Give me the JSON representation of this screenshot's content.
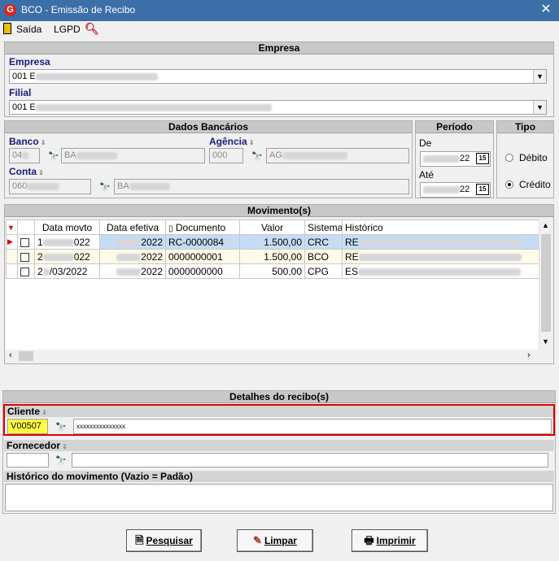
{
  "window": {
    "title": "BCO - Emissão de Recibo",
    "close": "✕",
    "icon_letter": "G"
  },
  "menu": {
    "exit": "Saída",
    "lgpd": "LGPD"
  },
  "empresa": {
    "header": "Empresa",
    "empresa_label": "Empresa",
    "empresa_value": "001 E",
    "filial_label": "Filial",
    "filial_value": "001 E"
  },
  "dados_bancarios": {
    "header": "Dados Bancários",
    "banco_label": "Banco",
    "banco_code": "04",
    "banco_name": "BA",
    "agencia_label": "Agência",
    "agencia_code": "000",
    "agencia_name": "AG",
    "conta_label": "Conta",
    "conta_code": "060",
    "conta_name": "BA"
  },
  "periodo": {
    "header": "Período",
    "de_label": "De",
    "de_value": "22",
    "ate_label": "Até",
    "ate_value": "22",
    "cal": "15"
  },
  "tipo": {
    "header": "Tipo",
    "debito": "Débito",
    "credito": "Crédito",
    "selected": "Crédito"
  },
  "movimentos": {
    "header": "Movimento(s)",
    "columns": [
      "Data movto",
      "Data efetiva",
      "Documento",
      "Valor",
      "Sistema",
      "Histórico"
    ],
    "rows": [
      {
        "data_movto": "1",
        "data_movto_end": "022",
        "data_efetiva": "2022",
        "documento": "RC-0000084",
        "valor": "1.500,00",
        "sistema": "CRC",
        "historico": "RE"
      },
      {
        "data_movto": "2",
        "data_movto_end": "022",
        "data_efetiva": "2022",
        "documento": "0000000001",
        "valor": "1.500,00",
        "sistema": "BCO",
        "historico": "RE"
      },
      {
        "data_movto": "2",
        "data_movto_end": "/03/2022",
        "data_efetiva": "2022",
        "documento": "0000000000",
        "valor": "500,00",
        "sistema": "CPG",
        "historico": "ES"
      }
    ]
  },
  "detalhes": {
    "header": "Detalhes do recibo(s)",
    "cliente_label": "Cliente",
    "cliente_code": "V00507",
    "cliente_name": "xxxxxxxxxxxxxxx",
    "fornecedor_label": "Fornecedor",
    "historico_label": "Histórico do movimento (Vazio = Padão)"
  },
  "buttons": {
    "pesquisar": "Pesquisar",
    "limpar": "Limpar",
    "imprimir": "Imprimir"
  },
  "colors": {
    "titlebar": "#3c6ea8",
    "highlight_border": "#e00000",
    "selected_row": "#c6dcf5",
    "code_highlight": "#ffff40"
  }
}
